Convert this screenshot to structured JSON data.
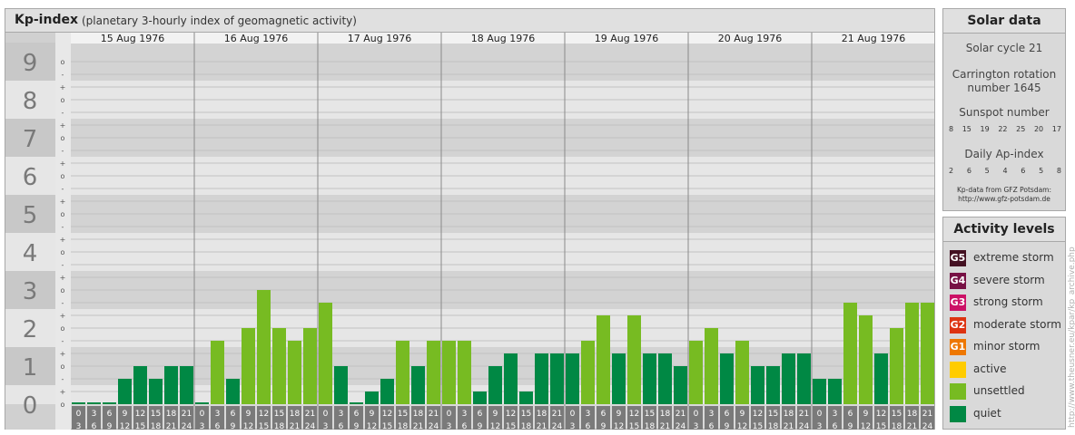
{
  "header": {
    "title": "Kp-index",
    "subtitle": "(planetary 3-hourly index of geomagnetic activity)"
  },
  "chart_data": {
    "type": "bar",
    "title": "Kp-index",
    "subtitle": "(planetary 3-hourly index of geomagnetic activity)",
    "ylim": [
      0,
      9
    ],
    "y_ticks": [
      "0",
      "1",
      "2",
      "3",
      "4",
      "5",
      "6",
      "7",
      "8",
      "9"
    ],
    "minor_ticks": [
      "o",
      "-",
      "+"
    ],
    "x_interval_labels": [
      [
        "0",
        "3"
      ],
      [
        "3",
        "6"
      ],
      [
        "6",
        "9"
      ],
      [
        "9",
        "12"
      ],
      [
        "12",
        "15"
      ],
      [
        "15",
        "18"
      ],
      [
        "18",
        "21"
      ],
      [
        "21",
        "24"
      ]
    ],
    "days": [
      {
        "date": "15 Aug 1976",
        "values": [
          0,
          0,
          0,
          0.667,
          1,
          0.667,
          1,
          1
        ]
      },
      {
        "date": "16 Aug 1976",
        "values": [
          0,
          1.667,
          0.667,
          2,
          3,
          2,
          1.667,
          2
        ]
      },
      {
        "date": "17 Aug 1976",
        "values": [
          2.667,
          1,
          0,
          0.333,
          0.667,
          1.667,
          1,
          1.667
        ]
      },
      {
        "date": "18 Aug 1976",
        "values": [
          1.667,
          1.667,
          0.333,
          1,
          1.333,
          0.333,
          1.333,
          1.333
        ]
      },
      {
        "date": "19 Aug 1976",
        "values": [
          1.333,
          1.667,
          2.333,
          1.333,
          2.333,
          1.333,
          1.333,
          1
        ]
      },
      {
        "date": "20 Aug 1976",
        "values": [
          1.667,
          2,
          1.333,
          1.667,
          1,
          1,
          1.333,
          1.333
        ]
      },
      {
        "date": "21 Aug 1976",
        "values": [
          0.667,
          0.667,
          2.667,
          2.333,
          1.333,
          2,
          2.667,
          2.667
        ]
      }
    ],
    "colors": {
      "quiet": "#008844",
      "unsettled": "#77bb22",
      "active": "#ffcc00",
      "minor_storm": "#ee7700",
      "moderate_storm": "#dd3311",
      "strong_storm": "#cc1166",
      "severe_storm": "#771144",
      "extreme_storm": "#441122"
    }
  },
  "solar": {
    "title": "Solar data",
    "solar_cycle": "Solar cycle 21",
    "carrington_line1": "Carrington rotation",
    "carrington_line2": "number 1645",
    "sunspot_title": "Sunspot number",
    "sunspot_values": [
      "8",
      "15",
      "19",
      "22",
      "25",
      "20",
      "17"
    ],
    "ap_title": "Daily Ap-index",
    "ap_values": [
      "2",
      "6",
      "5",
      "4",
      "6",
      "5",
      "8"
    ],
    "credit_line1": "Kp-data from GFZ Potsdam:",
    "credit_line2": "http://www.gfz-potsdam.de"
  },
  "activity": {
    "title": "Activity levels",
    "items": [
      {
        "badge": "G5",
        "label": "extreme storm",
        "color": "#441122"
      },
      {
        "badge": "G4",
        "label": "severe storm",
        "color": "#771144"
      },
      {
        "badge": "G3",
        "label": "strong storm",
        "color": "#cc1166"
      },
      {
        "badge": "G2",
        "label": "moderate storm",
        "color": "#dd3311"
      },
      {
        "badge": "G1",
        "label": "minor storm",
        "color": "#ee7700"
      },
      {
        "badge": "",
        "label": "active",
        "color": "#ffcc00"
      },
      {
        "badge": "",
        "label": "unsettled",
        "color": "#77bb22"
      },
      {
        "badge": "",
        "label": "quiet",
        "color": "#008844"
      }
    ]
  },
  "watermark": "http://www.theusner.eu/kpar/kp_archive.php"
}
